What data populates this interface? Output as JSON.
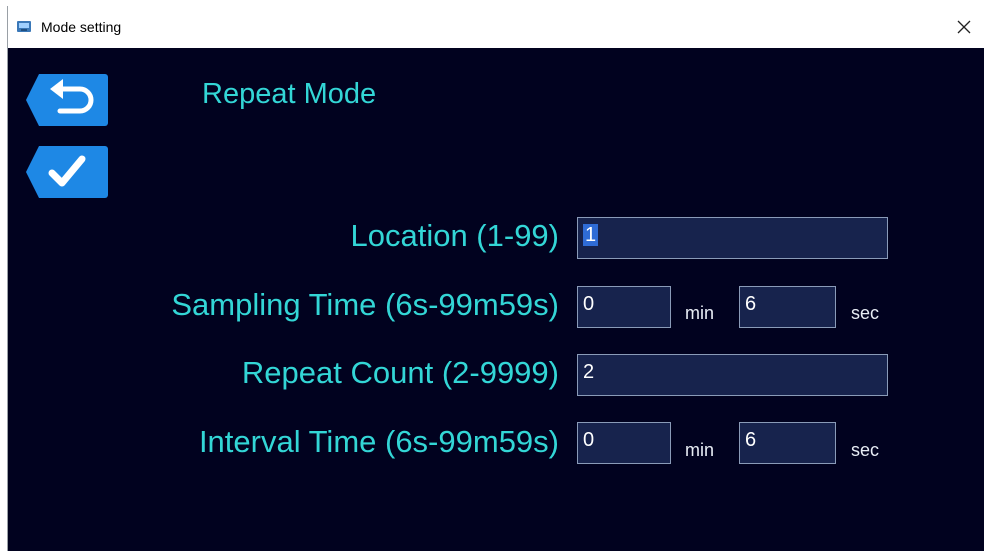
{
  "window": {
    "title": "Mode setting",
    "close_glyph": "✕"
  },
  "header": {
    "mode_title": "Repeat Mode",
    "back_icon": "return-arrow-icon",
    "confirm_icon": "checkmark-icon"
  },
  "form": {
    "location": {
      "label": "Location (1-99)",
      "value": "1"
    },
    "sampling_time": {
      "label": "Sampling Time (6s-99m59s)",
      "min_value": "0",
      "min_unit": "min",
      "sec_value": "6",
      "sec_unit": "sec"
    },
    "repeat_count": {
      "label": "Repeat Count (2-9999)",
      "value": "2"
    },
    "interval_time": {
      "label": "Interval Time (6s-99m59s)",
      "min_value": "0",
      "min_unit": "min",
      "sec_value": "6",
      "sec_unit": "sec"
    }
  },
  "colors": {
    "background": "#01021f",
    "label": "#33d6d6",
    "field_bg": "#17234d",
    "button_bg": "#1e88e5"
  }
}
